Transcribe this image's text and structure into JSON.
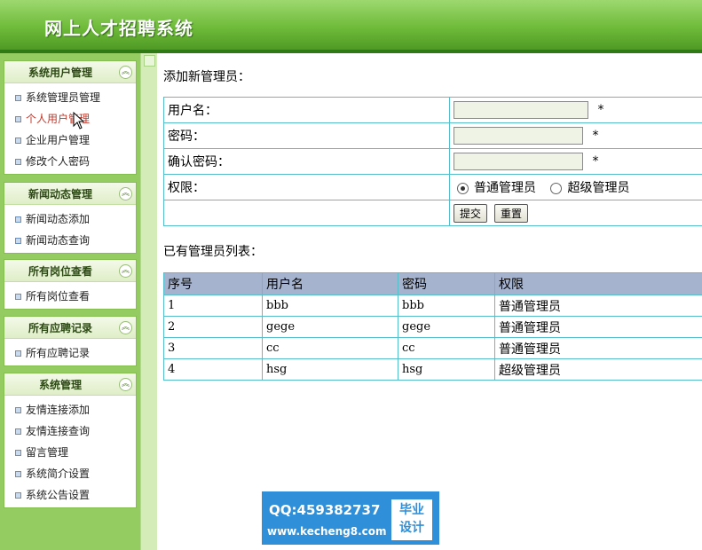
{
  "header": {
    "title": "网上人才招聘系统"
  },
  "sidebar": {
    "groups": [
      {
        "title": "系统用户管理",
        "items": [
          "系统管理员管理",
          "个人用户管理",
          "企业用户管理",
          "修改个人密码"
        ]
      },
      {
        "title": "新闻动态管理",
        "items": [
          "新闻动态添加",
          "新闻动态查询"
        ]
      },
      {
        "title": "所有岗位查看",
        "items": [
          "所有岗位查看"
        ]
      },
      {
        "title": "所有应聘记录",
        "items": [
          "所有应聘记录"
        ]
      },
      {
        "title": "系统管理",
        "items": [
          "友情连接添加",
          "友情连接查询",
          "留言管理",
          "系统简介设置",
          "系统公告设置"
        ]
      }
    ],
    "collapse_glyph": "︽"
  },
  "form": {
    "title": "添加新管理员：",
    "username_label": "用户名：",
    "password_label": "密码：",
    "confirm_label": "确认密码：",
    "role_label": "权限：",
    "required_mark": "*",
    "role_options": [
      "普通管理员",
      "超级管理员"
    ],
    "role_selected": "普通管理员",
    "submit_label": "提交",
    "reset_label": "重置",
    "username_value": "",
    "password_value": "",
    "confirm_value": ""
  },
  "list": {
    "title": "已有管理员列表：",
    "columns": [
      "序号",
      "用户名",
      "密码",
      "权限"
    ],
    "rows": [
      [
        "1",
        "bbb",
        "bbb",
        "普通管理员"
      ],
      [
        "2",
        "gege",
        "gege",
        "普通管理员"
      ],
      [
        "3",
        "cc",
        "cc",
        "普通管理员"
      ],
      [
        "4",
        "hsg",
        "hsg",
        "超级管理员"
      ]
    ]
  },
  "watermark": {
    "qq": "QQ:459382737",
    "url": "www.kecheng8.com",
    "badge_line1": "毕业",
    "badge_line2": "设计"
  },
  "colors": {
    "header_green": "#6fbb3a",
    "sidebar_green": "#94cc62",
    "table_border": "#55c0cc",
    "table_head": "#a6b3cf",
    "active_link": "#c0392b"
  }
}
